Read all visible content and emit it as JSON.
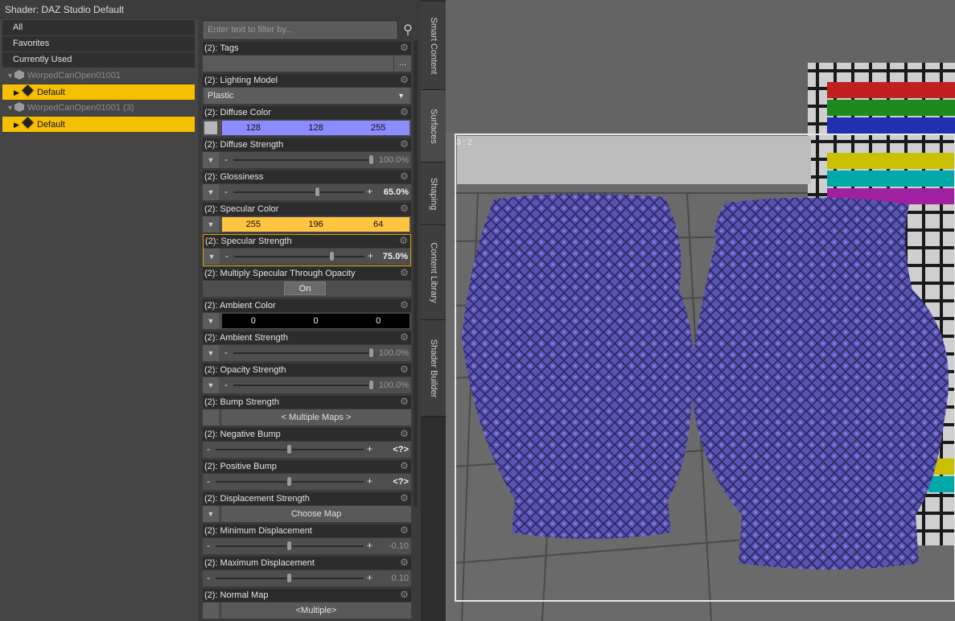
{
  "shader_panel": {
    "title": "Shader: DAZ Studio Default"
  },
  "tree": {
    "categories": [
      "All",
      "Favorites",
      "Currently Used"
    ],
    "objects": [
      {
        "name": "WorpedCanOpen01001",
        "surface": "Default"
      },
      {
        "name": "WorpedCanOpen01001 (3)",
        "surface": "Default"
      }
    ]
  },
  "filter": {
    "placeholder": "Enter text to filter by..."
  },
  "properties": {
    "tags": {
      "title": "(2): Tags",
      "button": "..."
    },
    "lighting_model": {
      "title": "(2): Lighting Model",
      "value": "Plastic"
    },
    "diffuse_color": {
      "title": "(2): Diffuse Color",
      "r": "128",
      "g": "128",
      "b": "255",
      "color": "#8a8cff"
    },
    "diffuse_strength": {
      "title": "(2): Diffuse Strength",
      "value": "100.0%",
      "level": 1.0
    },
    "glossiness": {
      "title": "(2): Glossiness",
      "value": "65.0%",
      "level": 0.65,
      "minus": "-",
      "plus": "+"
    },
    "specular_color": {
      "title": "(2): Specular Color",
      "r": "255",
      "g": "196",
      "b": "64",
      "color": "#ffc440"
    },
    "specular_strength": {
      "title": "(2): Specular Strength",
      "value": "75.0%",
      "level": 0.75,
      "minus": "-",
      "plus": "+"
    },
    "multiply_specular": {
      "title": "(2): Multiply Specular Through Opacity",
      "value": "On"
    },
    "ambient_color": {
      "title": "(2): Ambient Color",
      "r": "0",
      "g": "0",
      "b": "0",
      "color": "#000000"
    },
    "ambient_strength": {
      "title": "(2): Ambient Strength",
      "value": "100.0%",
      "level": 1.0
    },
    "opacity_strength": {
      "title": "(2): Opacity Strength",
      "value": "100.0%",
      "level": 1.0
    },
    "bump_strength": {
      "title": "(2): Bump Strength",
      "value": "< Multiple Maps >"
    },
    "negative_bump": {
      "title": "(2): Negative Bump",
      "value": "<?>",
      "level": 0.5,
      "minus": "-",
      "plus": "+"
    },
    "positive_bump": {
      "title": "(2): Positive Bump",
      "value": "<?>",
      "level": 0.5,
      "minus": "-",
      "plus": "+"
    },
    "displacement_strength": {
      "title": "(2): Displacement Strength",
      "value": "Choose Map"
    },
    "minimum_displacement": {
      "title": "(2): Minimum Displacement",
      "value": "-0.10",
      "level": 0.5,
      "minus": "-",
      "plus": "+"
    },
    "maximum_displacement": {
      "title": "(2): Maximum Displacement",
      "value": "0.10",
      "level": 0.5,
      "minus": "-",
      "plus": "+"
    },
    "normal_map": {
      "title": "(2): Normal Map",
      "value": "<Multiple>"
    }
  },
  "side_tabs": [
    "Smart Content",
    "Surfaces",
    "Shaping",
    "Content Library",
    "Shader Builder"
  ],
  "viewport": {
    "aspect_label": "3 : 2"
  },
  "colors": {
    "selection": "#f5c000",
    "vase_pattern": "#5a55b8"
  }
}
